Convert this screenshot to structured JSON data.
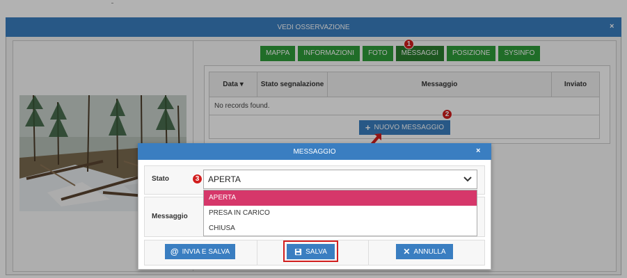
{
  "modal": {
    "title": "VEDI OSSERVAZIONE",
    "close": "×"
  },
  "tabs": [
    {
      "label": "MAPPA"
    },
    {
      "label": "INFORMAZIONI"
    },
    {
      "label": "FOTO"
    },
    {
      "label": "MESSAGGI",
      "active": true
    },
    {
      "label": "POSIZIONE"
    },
    {
      "label": "SYSINFO"
    }
  ],
  "grid": {
    "columns": [
      "Data ▾",
      "Stato segnalazione",
      "Messaggio",
      "Inviato"
    ],
    "empty_text": "No records found.",
    "add_button": "NUOVO MESSAGGIO"
  },
  "dialog": {
    "title": "MESSAGGIO",
    "close": "×",
    "stato_label": "Stato",
    "stato_value": "APERTA",
    "messaggio_label": "Messaggio",
    "options": [
      "APERTA",
      "PRESA IN CARICO",
      "CHIUSA"
    ],
    "selected_option": "APERTA",
    "buttons": {
      "invia_salva": "INVIA E SALVA",
      "salva": "SALVA",
      "annulla": "ANNULLA"
    }
  },
  "badges": [
    "1",
    "2",
    "3"
  ],
  "colors": {
    "header_blue": "#3a7ec1",
    "tab_green": "#2e9d3a",
    "selected_option": "#d6376a",
    "annotation_red": "#d11e1e"
  }
}
